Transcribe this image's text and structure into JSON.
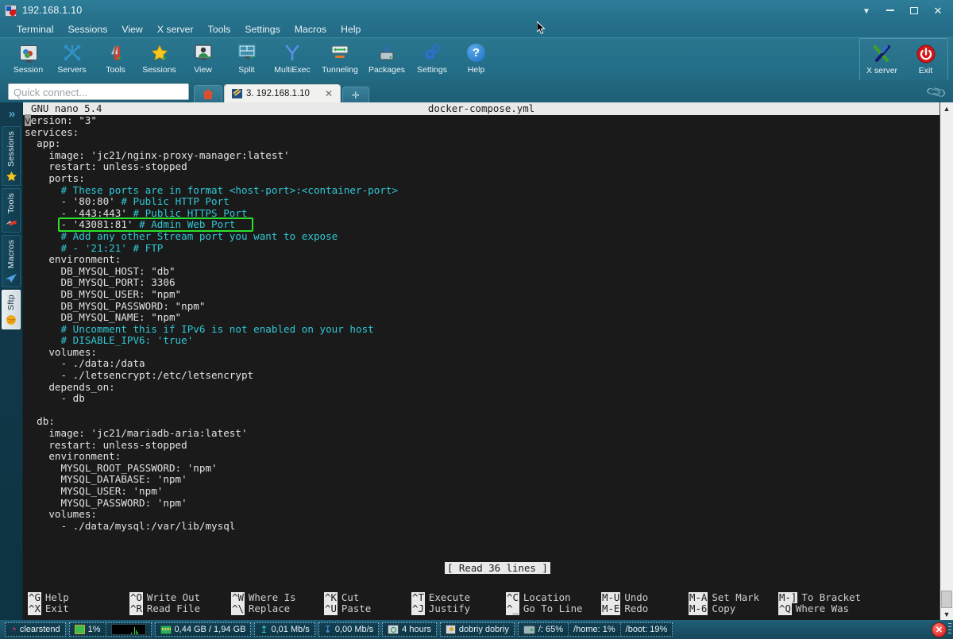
{
  "window": {
    "title": "192.168.1.10",
    "app_icon": "mobaxterm-icon",
    "buttons": {
      "chevron": "▼",
      "minimize": "–",
      "maximize": "▢",
      "close": "✕"
    }
  },
  "menubar": {
    "items": [
      "Terminal",
      "Sessions",
      "View",
      "X server",
      "Tools",
      "Settings",
      "Macros",
      "Help"
    ]
  },
  "toolbar": {
    "items": [
      {
        "label": "Session",
        "icon": "session-monitor-icon"
      },
      {
        "label": "Servers",
        "icon": "servers-network-icon"
      },
      {
        "label": "Tools",
        "icon": "tools-knife-icon"
      },
      {
        "label": "Sessions",
        "icon": "sessions-star-icon"
      },
      {
        "label": "View",
        "icon": "view-user-monitor-icon"
      },
      {
        "label": "Split",
        "icon": "split-panes-icon"
      },
      {
        "label": "MultiExec",
        "icon": "multiexec-fork-icon"
      },
      {
        "label": "Tunneling",
        "icon": "tunneling-arrows-icon"
      },
      {
        "label": "Packages",
        "icon": "packages-download-icon"
      },
      {
        "label": "Settings",
        "icon": "settings-gear-icon"
      },
      {
        "label": "Help",
        "icon": "help-question-icon"
      }
    ],
    "right_items": [
      {
        "label": "X server",
        "icon": "x-server-icon"
      },
      {
        "label": "Exit",
        "icon": "power-exit-icon"
      }
    ]
  },
  "quick_connect": {
    "placeholder": "Quick connect..."
  },
  "tabs": {
    "home_label": "",
    "items": [
      {
        "label": "3. 192.168.1.10",
        "icon": "terminal-pencil-icon",
        "close": "✕",
        "active": true
      }
    ],
    "add_label": "✛"
  },
  "sidebar": {
    "expand_icon": "»",
    "items": [
      {
        "label": "Sessions",
        "icon": "star-icon",
        "active": false
      },
      {
        "label": "Tools",
        "icon": "knife-icon",
        "active": false
      },
      {
        "label": "Macros",
        "icon": "paper-plane-icon",
        "active": false
      },
      {
        "label": "Sftp",
        "icon": "globe-icon",
        "active": true
      }
    ]
  },
  "terminal": {
    "editor_header": {
      "left": "GNU nano 5.4",
      "center": "docker-compose.yml"
    },
    "highlight_color": "#2ae02a",
    "comment_color": "#31c7d4",
    "text_color": "#e2e2e2",
    "background": "#1a1a1a",
    "lines": [
      {
        "text": "version: \"3\"",
        "cursor_at": 0
      },
      {
        "text": "services:"
      },
      {
        "text": "  app:"
      },
      {
        "text": "    image: 'jc21/nginx-proxy-manager:latest'"
      },
      {
        "text": "    restart: unless-stopped"
      },
      {
        "text": "    ports:"
      },
      {
        "text": "      # These ports are in format <host-port>:<container-port>",
        "comment": true
      },
      {
        "text": "      - '80:80' # Public HTTP Port",
        "comment_from": 16
      },
      {
        "text": "      - '443:443' # Public HTTPS Port",
        "comment_from": 18
      },
      {
        "text": "      - '43081:81' # Admin Web Port",
        "comment_from": 19,
        "highlighted": true
      },
      {
        "text": "      # Add any other Stream port you want to expose",
        "comment": true
      },
      {
        "text": "      # - '21:21' # FTP",
        "comment": true
      },
      {
        "text": "    environment:"
      },
      {
        "text": "      DB_MYSQL_HOST: \"db\""
      },
      {
        "text": "      DB_MYSQL_PORT: 3306"
      },
      {
        "text": "      DB_MYSQL_USER: \"npm\""
      },
      {
        "text": "      DB_MYSQL_PASSWORD: \"npm\""
      },
      {
        "text": "      DB_MYSQL_NAME: \"npm\""
      },
      {
        "text": "      # Uncomment this if IPv6 is not enabled on your host",
        "comment": true
      },
      {
        "text": "      # DISABLE_IPV6: 'true'",
        "comment": true
      },
      {
        "text": "    volumes:"
      },
      {
        "text": "      - ./data:/data"
      },
      {
        "text": "      - ./letsencrypt:/etc/letsencrypt"
      },
      {
        "text": "    depends_on:"
      },
      {
        "text": "      - db"
      },
      {
        "text": ""
      },
      {
        "text": "  db:"
      },
      {
        "text": "    image: 'jc21/mariadb-aria:latest'"
      },
      {
        "text": "    restart: unless-stopped"
      },
      {
        "text": "    environment:"
      },
      {
        "text": "      MYSQL_ROOT_PASSWORD: 'npm'"
      },
      {
        "text": "      MYSQL_DATABASE: 'npm'"
      },
      {
        "text": "      MYSQL_USER: 'npm'"
      },
      {
        "text": "      MYSQL_PASSWORD: 'npm'"
      },
      {
        "text": "    volumes:"
      },
      {
        "text": "      - ./data/mysql:/var/lib/mysql"
      }
    ],
    "status_message": "[ Read 36 lines ]",
    "shortcuts": [
      [
        {
          "key": "^G",
          "label": "Help"
        },
        {
          "key": "^X",
          "label": "Exit"
        }
      ],
      [
        {
          "key": "^O",
          "label": "Write Out"
        },
        {
          "key": "^R",
          "label": "Read File"
        }
      ],
      [
        {
          "key": "^W",
          "label": "Where Is"
        },
        {
          "key": "^\\",
          "label": "Replace"
        }
      ],
      [
        {
          "key": "^K",
          "label": "Cut"
        },
        {
          "key": "^U",
          "label": "Paste"
        }
      ],
      [
        {
          "key": "^T",
          "label": "Execute"
        },
        {
          "key": "^J",
          "label": "Justify"
        }
      ],
      [
        {
          "key": "^C",
          "label": "Location"
        },
        {
          "key": "^_",
          "label": "Go To Line"
        }
      ],
      [
        {
          "key": "M-U",
          "label": "Undo"
        },
        {
          "key": "M-E",
          "label": "Redo"
        }
      ],
      [
        {
          "key": "M-A",
          "label": "Set Mark"
        },
        {
          "key": "M-6",
          "label": "Copy"
        }
      ],
      [
        {
          "key": "M-]",
          "label": "To Bracket"
        },
        {
          "key": "^Q",
          "label": "Where Was"
        }
      ]
    ]
  },
  "statusbar": {
    "groups": [
      {
        "cells": [
          {
            "icon": "debian-icon",
            "label": "clearstend"
          }
        ]
      },
      {
        "cells": [
          {
            "icon": "cpu-icon",
            "label": "1%"
          },
          {
            "icon": "cpu-graph",
            "label": ""
          }
        ]
      },
      {
        "cells": [
          {
            "icon": "ram-icon",
            "label": "0,44 GB / 1,94 GB"
          }
        ]
      },
      {
        "cells": [
          {
            "icon": "upload-icon",
            "label": "0,01 Mb/s"
          }
        ]
      },
      {
        "cells": [
          {
            "icon": "download-icon",
            "label": "0,00 Mb/s"
          }
        ]
      },
      {
        "cells": [
          {
            "icon": "uptime-clock-icon",
            "label": "4 hours"
          }
        ]
      },
      {
        "cells": [
          {
            "icon": "user-icon",
            "label": "dobriy  dobriy"
          }
        ]
      },
      {
        "cells": [
          {
            "icon": "disk-icon",
            "label": "/: 65%"
          },
          {
            "icon": "",
            "label": "/home: 1%"
          },
          {
            "icon": "",
            "label": "/boot: 19%"
          }
        ]
      }
    ],
    "close_label": "✕"
  }
}
